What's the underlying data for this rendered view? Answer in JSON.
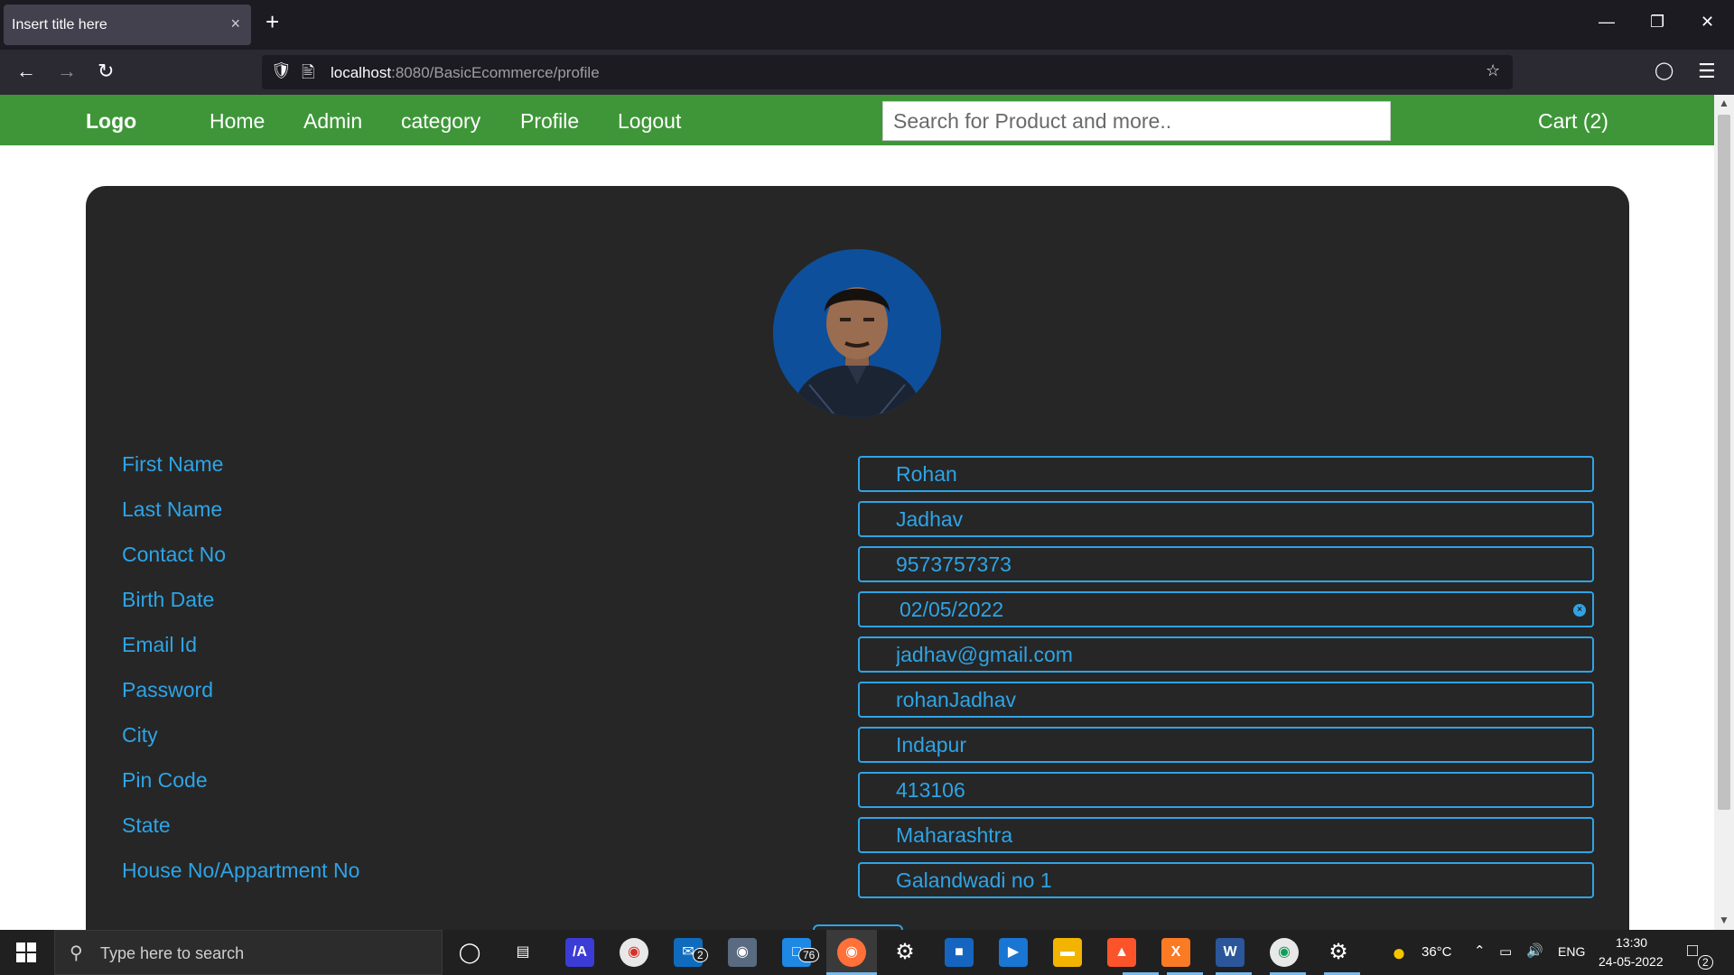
{
  "browser": {
    "tab_title": "Insert title here",
    "tab_close": "×",
    "new_tab": "+",
    "url_host": "localhost",
    "url_rest": ":8080/BasicEcommerce/profile"
  },
  "site": {
    "logo": "Logo",
    "nav": [
      "Home",
      "Admin",
      "category",
      "Profile",
      "Logout"
    ],
    "search_placeholder": "Search for Product and more..",
    "cart": "Cart (2)"
  },
  "profile": {
    "fields": [
      {
        "label": "First Name",
        "value": "Rohan"
      },
      {
        "label": "Last Name",
        "value": "Jadhav"
      },
      {
        "label": "Contact No",
        "value": "9573757373"
      },
      {
        "label": "Birth Date",
        "value": "02/05/2022"
      },
      {
        "label": "Email Id",
        "value": "jadhav@gmail.com"
      },
      {
        "label": "Password",
        "value": "rohanJadhav"
      },
      {
        "label": "City",
        "value": "Indapur"
      },
      {
        "label": "Pin Code",
        "value": "413106"
      },
      {
        "label": "State",
        "value": "Maharashtra"
      },
      {
        "label": "House No/Appartment No",
        "value": "Galandwadi no 1"
      }
    ]
  },
  "taskbar": {
    "search_text": "Type here to search",
    "mail_badge": "2",
    "files_badge": "76",
    "notif_badge": "2",
    "temperature": "36°C",
    "language": "ENG",
    "time": "13:30",
    "date": "24-05-2022"
  },
  "colors": {
    "header_green": "#3f9639",
    "accent_blue": "#2ea4e6",
    "card_bg": "#262626"
  }
}
